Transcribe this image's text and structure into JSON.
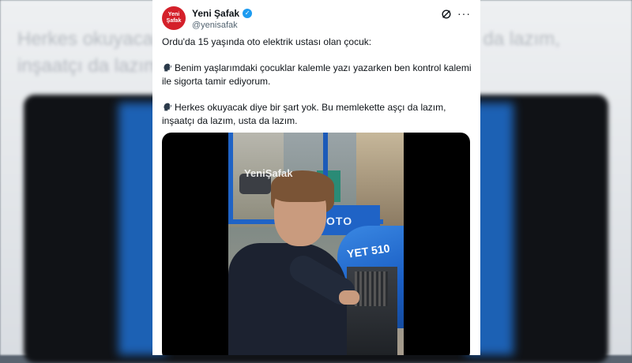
{
  "background": {
    "line1": "Herkes okuyacak diye bir şart yok. Bu memlekette aşçı da lazım,",
    "line2": "inşaatçı da lazım, usta da lazım."
  },
  "tweet": {
    "avatar_text_top": "Yeni",
    "avatar_text_bottom": "Şafak",
    "display_name": "Yeni Şafak",
    "handle": "@yenisafak",
    "paragraphs": [
      "Ordu'da 15 yaşında oto elektrik ustası olan çocuk:",
      "Benim yaşlarımdaki çocuklar kalemle yazı yazarken ben kontrol kalemi ile sigorta tamir ediyorum.",
      "Herkes okuyacak diye bir şart yok. Bu memlekette aşçı da lazım, inşaatçı da lazım, usta da lazım."
    ],
    "media": {
      "watermark": "YeniŞafak",
      "hood_label": "YET 510",
      "panel_label": "OTO"
    }
  },
  "icons": {
    "verified": "verified-badge-icon",
    "grok": "grok-icon",
    "more": "more-icon",
    "speaking": "speaking-head-icon"
  },
  "colors": {
    "brand_red": "#d4202a",
    "verified_blue": "#1d9bf0",
    "tractor_blue": "#1f63c6"
  }
}
